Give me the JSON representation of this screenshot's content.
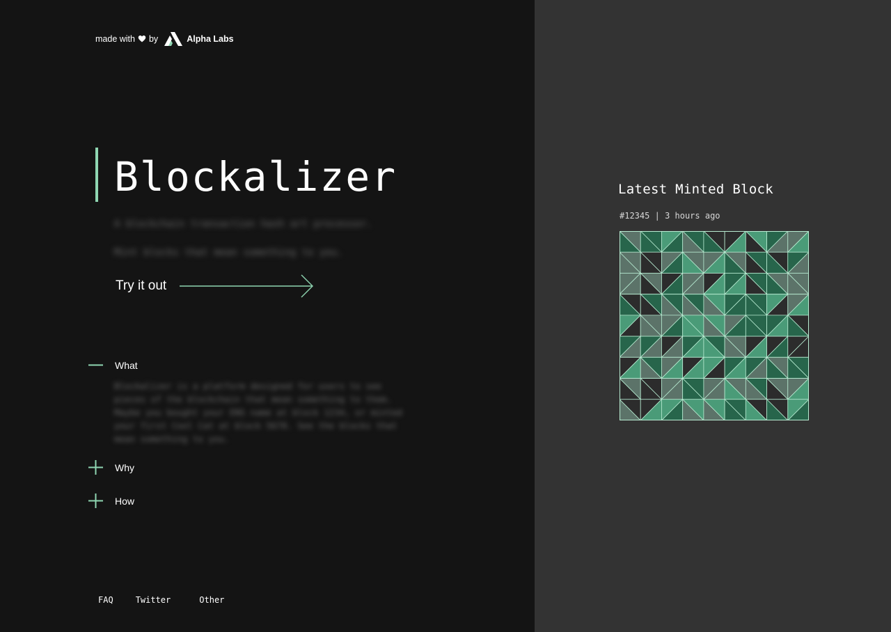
{
  "made_with": {
    "prefix": "made with",
    "by": "by",
    "brand": "Alpha Labs"
  },
  "hero": {
    "title": "Blockalizer",
    "tagline_1": "A blockchain transaction hash art processor.",
    "tagline_2": "Mint blocks that mean something to you.",
    "cta_label": "Try it out"
  },
  "accordion": {
    "items": [
      {
        "label": "What",
        "expanded": true
      },
      {
        "label": "Why",
        "expanded": false
      },
      {
        "label": "How",
        "expanded": false
      }
    ],
    "what_body": "Blockalizer is a platform designed for users to see pieces of the blockchain that mean something to them. Maybe you bought your ENS name at block 1234, or minted your first Cool Cat at block 5678. See the blocks that mean something to you."
  },
  "footer": {
    "faq": "FAQ",
    "twitter": "Twitter",
    "other": "Other"
  },
  "latest": {
    "title": "Latest Minted Block",
    "block_number": "#12345",
    "separator": "|",
    "time_ago": "3 hours ago"
  },
  "colors": {
    "accent": "#8fd6b2",
    "panel_bg": "#141414",
    "right_bg": "#333333",
    "tile_dark": "#2c2c2c",
    "tile_gray": "#5c7369",
    "tile_green": "#27654b",
    "tile_light_green": "#4a9b78",
    "tile_line": "#b8ecd2"
  },
  "icons": {
    "heart": "heart-icon",
    "logo": "alpha-labs-logo",
    "arrow": "arrow-right-icon",
    "minus": "minus-icon",
    "plus": "plus-icon"
  }
}
